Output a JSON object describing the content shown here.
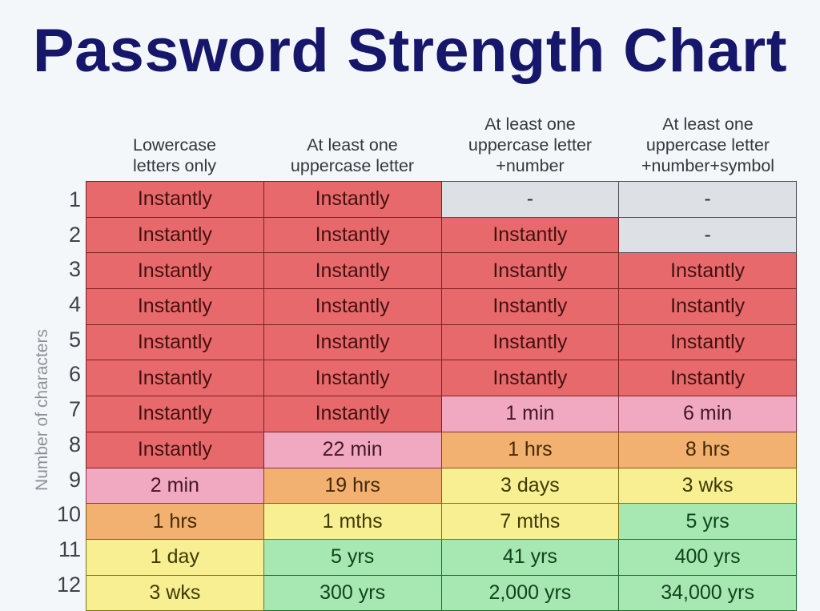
{
  "title": "Password Strength Chart",
  "y_axis_label": "Number of characters",
  "colors": {
    "background": "#f4f7fa",
    "title": "#16176b",
    "axis_label": "#8d9196",
    "header_text": "#34373b",
    "instant_red": "#e8696c",
    "pink": "#f0a9c0",
    "orange": "#f2b171",
    "yellow": "#f7ef92",
    "green": "#a7e7b2",
    "gray": "#dde1e5"
  },
  "chart_data": {
    "type": "heatmap",
    "title": "Password Strength Chart",
    "xlabel": "",
    "ylabel": "Number of characters",
    "grid": true,
    "legend": "none",
    "categories": [
      "Lowercase letters only",
      "At least one uppercase letter",
      "At least one uppercase letter +number",
      "At least one uppercase letter +number+symbol"
    ],
    "column_headers": [
      [
        "Lowercase",
        "letters only"
      ],
      [
        "At least one",
        "uppercase letter"
      ],
      [
        "At least one",
        "uppercase letter",
        "+number"
      ],
      [
        "At least one",
        "uppercase letter",
        "+number+symbol"
      ]
    ],
    "row_labels": [
      "1",
      "2",
      "3",
      "4",
      "5",
      "6",
      "7",
      "8",
      "9",
      "10",
      "11",
      "12"
    ],
    "rows": [
      {
        "chars": "1",
        "cells": [
          {
            "text": "Instantly",
            "color": "red"
          },
          {
            "text": "Instantly",
            "color": "red"
          },
          {
            "text": "-",
            "color": "gray"
          },
          {
            "text": "-",
            "color": "gray"
          }
        ]
      },
      {
        "chars": "2",
        "cells": [
          {
            "text": "Instantly",
            "color": "red"
          },
          {
            "text": "Instantly",
            "color": "red"
          },
          {
            "text": "Instantly",
            "color": "red"
          },
          {
            "text": "-",
            "color": "gray"
          }
        ]
      },
      {
        "chars": "3",
        "cells": [
          {
            "text": "Instantly",
            "color": "red"
          },
          {
            "text": "Instantly",
            "color": "red"
          },
          {
            "text": "Instantly",
            "color": "red"
          },
          {
            "text": "Instantly",
            "color": "red"
          }
        ]
      },
      {
        "chars": "4",
        "cells": [
          {
            "text": "Instantly",
            "color": "red"
          },
          {
            "text": "Instantly",
            "color": "red"
          },
          {
            "text": "Instantly",
            "color": "red"
          },
          {
            "text": "Instantly",
            "color": "red"
          }
        ]
      },
      {
        "chars": "5",
        "cells": [
          {
            "text": "Instantly",
            "color": "red"
          },
          {
            "text": "Instantly",
            "color": "red"
          },
          {
            "text": "Instantly",
            "color": "red"
          },
          {
            "text": "Instantly",
            "color": "red"
          }
        ]
      },
      {
        "chars": "6",
        "cells": [
          {
            "text": "Instantly",
            "color": "red"
          },
          {
            "text": "Instantly",
            "color": "red"
          },
          {
            "text": "Instantly",
            "color": "red"
          },
          {
            "text": "Instantly",
            "color": "red"
          }
        ]
      },
      {
        "chars": "7",
        "cells": [
          {
            "text": "Instantly",
            "color": "red"
          },
          {
            "text": "Instantly",
            "color": "red"
          },
          {
            "text": "1 min",
            "color": "pink"
          },
          {
            "text": "6 min",
            "color": "pink"
          }
        ]
      },
      {
        "chars": "8",
        "cells": [
          {
            "text": "Instantly",
            "color": "red"
          },
          {
            "text": "22 min",
            "color": "pink"
          },
          {
            "text": "1 hrs",
            "color": "orange"
          },
          {
            "text": "8 hrs",
            "color": "orange"
          }
        ]
      },
      {
        "chars": "9",
        "cells": [
          {
            "text": "2 min",
            "color": "pink"
          },
          {
            "text": "19 hrs",
            "color": "orange"
          },
          {
            "text": "3 days",
            "color": "yellow"
          },
          {
            "text": "3 wks",
            "color": "yellow"
          }
        ]
      },
      {
        "chars": "10",
        "cells": [
          {
            "text": "1 hrs",
            "color": "orange"
          },
          {
            "text": "1 mths",
            "color": "yellow"
          },
          {
            "text": "7 mths",
            "color": "yellow"
          },
          {
            "text": "5 yrs",
            "color": "green"
          }
        ]
      },
      {
        "chars": "11",
        "cells": [
          {
            "text": "1 day",
            "color": "yellow"
          },
          {
            "text": "5 yrs",
            "color": "green"
          },
          {
            "text": "41 yrs",
            "color": "green"
          },
          {
            "text": "400 yrs",
            "color": "green"
          }
        ]
      },
      {
        "chars": "12",
        "cells": [
          {
            "text": "3 wks",
            "color": "yellow"
          },
          {
            "text": "300 yrs",
            "color": "green"
          },
          {
            "text": "2,000 yrs",
            "color": "green"
          },
          {
            "text": "34,000 yrs",
            "color": "green"
          }
        ]
      }
    ]
  }
}
